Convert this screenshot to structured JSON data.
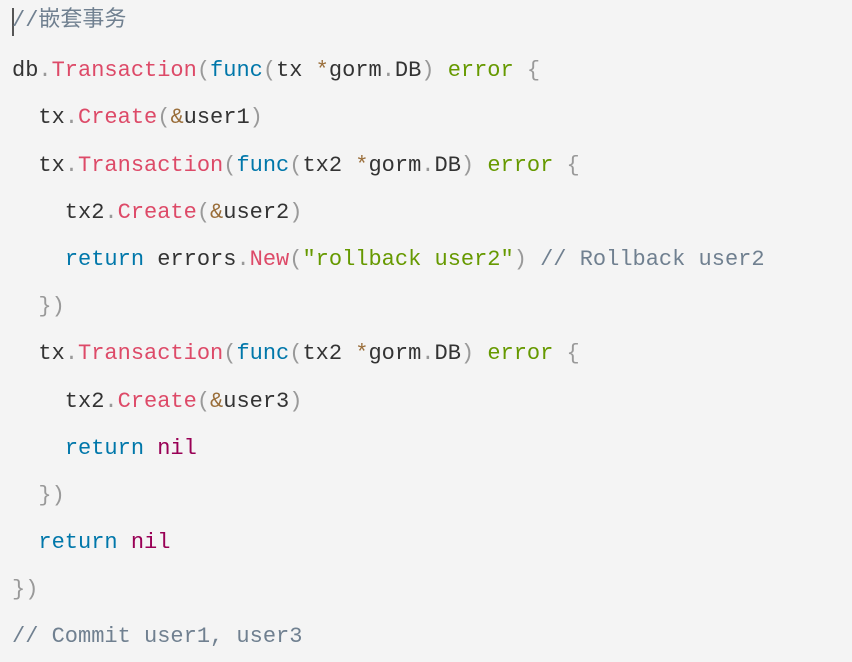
{
  "colors": {
    "background": "#f4f4f4",
    "function": "#dd4a68",
    "keyword": "#0077aa",
    "builtin": "#669900",
    "comment": "#708090",
    "nil": "#990055"
  },
  "code_lines": [
    [
      [
        "//嵌套事务",
        "comment"
      ]
    ],
    [
      [
        "db",
        "plain"
      ],
      [
        ".",
        "punct"
      ],
      [
        "Transaction",
        "function"
      ],
      [
        "(",
        "punct"
      ],
      [
        "func",
        "keyword"
      ],
      [
        "(",
        "punct"
      ],
      [
        "tx ",
        "plain"
      ],
      [
        "*",
        "op"
      ],
      [
        "gorm",
        "plain"
      ],
      [
        ".",
        "punct"
      ],
      [
        "DB",
        "plain"
      ],
      [
        ")",
        "punct"
      ],
      [
        " ",
        "plain"
      ],
      [
        "error",
        "builtin"
      ],
      [
        " {",
        "punct"
      ]
    ],
    [
      [
        "  tx",
        "plain"
      ],
      [
        ".",
        "punct"
      ],
      [
        "Create",
        "function"
      ],
      [
        "(",
        "punct"
      ],
      [
        "&",
        "op"
      ],
      [
        "user1",
        "plain"
      ],
      [
        ")",
        "punct"
      ]
    ],
    [
      [
        "  tx",
        "plain"
      ],
      [
        ".",
        "punct"
      ],
      [
        "Transaction",
        "function"
      ],
      [
        "(",
        "punct"
      ],
      [
        "func",
        "keyword"
      ],
      [
        "(",
        "punct"
      ],
      [
        "tx2 ",
        "plain"
      ],
      [
        "*",
        "op"
      ],
      [
        "gorm",
        "plain"
      ],
      [
        ".",
        "punct"
      ],
      [
        "DB",
        "plain"
      ],
      [
        ")",
        "punct"
      ],
      [
        " ",
        "plain"
      ],
      [
        "error",
        "builtin"
      ],
      [
        " {",
        "punct"
      ]
    ],
    [
      [
        "    tx2",
        "plain"
      ],
      [
        ".",
        "punct"
      ],
      [
        "Create",
        "function"
      ],
      [
        "(",
        "punct"
      ],
      [
        "&",
        "op"
      ],
      [
        "user2",
        "plain"
      ],
      [
        ")",
        "punct"
      ]
    ],
    [
      [
        "    ",
        "plain"
      ],
      [
        "return",
        "keyword"
      ],
      [
        " errors",
        "plain"
      ],
      [
        ".",
        "punct"
      ],
      [
        "New",
        "function"
      ],
      [
        "(",
        "punct"
      ],
      [
        "\"rollback user2\"",
        "string"
      ],
      [
        ")",
        "punct"
      ],
      [
        " // Rollback user2",
        "comment"
      ]
    ],
    [
      [
        "  })",
        "punct"
      ]
    ],
    [
      [
        "  tx",
        "plain"
      ],
      [
        ".",
        "punct"
      ],
      [
        "Transaction",
        "function"
      ],
      [
        "(",
        "punct"
      ],
      [
        "func",
        "keyword"
      ],
      [
        "(",
        "punct"
      ],
      [
        "tx2 ",
        "plain"
      ],
      [
        "*",
        "op"
      ],
      [
        "gorm",
        "plain"
      ],
      [
        ".",
        "punct"
      ],
      [
        "DB",
        "plain"
      ],
      [
        ")",
        "punct"
      ],
      [
        " ",
        "plain"
      ],
      [
        "error",
        "builtin"
      ],
      [
        " {",
        "punct"
      ]
    ],
    [
      [
        "    tx2",
        "plain"
      ],
      [
        ".",
        "punct"
      ],
      [
        "Create",
        "function"
      ],
      [
        "(",
        "punct"
      ],
      [
        "&",
        "op"
      ],
      [
        "user3",
        "plain"
      ],
      [
        ")",
        "punct"
      ]
    ],
    [
      [
        "    ",
        "plain"
      ],
      [
        "return",
        "keyword"
      ],
      [
        " ",
        "plain"
      ],
      [
        "nil",
        "nil"
      ]
    ],
    [
      [
        "  })",
        "punct"
      ]
    ],
    [
      [
        "  ",
        "plain"
      ],
      [
        "return",
        "keyword"
      ],
      [
        " ",
        "plain"
      ],
      [
        "nil",
        "nil"
      ]
    ],
    [
      [
        "})",
        "punct"
      ]
    ],
    [
      [
        "// Commit user1, user3",
        "comment"
      ]
    ]
  ]
}
